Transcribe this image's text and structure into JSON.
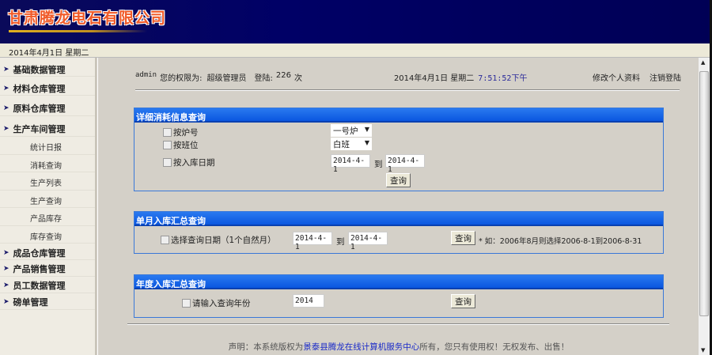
{
  "header": {
    "logo_text": "甘肃腾龙电石有限公司"
  },
  "datebar": {
    "date": "2014年4月1日 星期二"
  },
  "sidebar": {
    "groups_top": [
      "基础数据管理",
      "材料仓库管理",
      "原料仓库管理",
      "生产车间管理"
    ],
    "sub_items": [
      "统计日报",
      "消耗查询",
      "生产列表",
      "生产查询",
      "产品库存",
      "库存查询"
    ],
    "groups_bottom": [
      "成品仓库管理",
      "产品销售管理",
      "员工数据管理",
      "磅单管理"
    ]
  },
  "info": {
    "user": "admin",
    "perm_label": "您的权限为:",
    "role": "超级管理员",
    "login_label": "登陆:",
    "login_count": "226",
    "login_unit": "次",
    "date": "2014年4月1日 星期二",
    "time": "7:51:52下午",
    "edit_profile": "修改个人资料",
    "logout": "注销登陆"
  },
  "panel1": {
    "title": "详细消耗信息查询",
    "cb_furnace": "按炉号",
    "cb_shift": "按班位",
    "cb_date": "按入库日期",
    "furnace_value": "一号炉",
    "shift_value": "白班",
    "date_from": "2014-4-1",
    "to": "到",
    "date_to": "2014-4-1",
    "query": "查询"
  },
  "panel2": {
    "title": "单月入库汇总查询",
    "cb_label": "选择查询日期（1个自然月）",
    "date_from": "2014-4-1",
    "to": "到",
    "date_to": "2014-4-1",
    "query": "查询",
    "hint": "* 如：2006年8月则选择2006-8-1到2006-8-31"
  },
  "panel3": {
    "title": "年度入库汇总查询",
    "cb_label": "请输入查询年份",
    "year": "2014",
    "query": "查询"
  },
  "footer": {
    "prefix": "声明：本系统版权为",
    "link": "景泰县腾龙在线计算机服务中心",
    "suffix": "所有，您只有使用权！无权发布、出售！"
  }
}
